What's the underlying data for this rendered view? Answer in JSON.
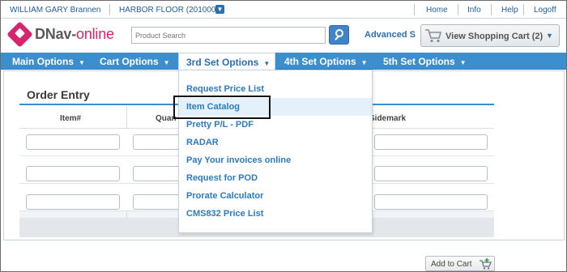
{
  "topbar": {
    "user": "WILLIAM GARY Brannen",
    "store": "HARBOR FLOOR (201000)",
    "links": [
      "Home",
      "Info",
      "Help",
      "Logoff"
    ]
  },
  "header": {
    "logo_main": "DNav-",
    "logo_accent": "online",
    "search_placeholder": "Product Search",
    "advanced_label": "Advanced S",
    "cart_label": "View Shopping Cart (2)"
  },
  "nav": {
    "items": [
      "Main Options",
      "Cart Options",
      "3rd Set Options",
      "4th Set Options",
      "5th Set Options"
    ],
    "active": "3rd Set Options"
  },
  "dropdown": {
    "items": [
      "Request Price List",
      "Item Catalog",
      "Pretty P/L - PDF",
      "RADAR",
      "Pay Your invoices online",
      "Request for POD",
      "Prorate Calculator",
      "CMS832 Price List"
    ],
    "highlighted": "Item Catalog"
  },
  "order_entry": {
    "title": "Order Entry",
    "columns": [
      "Item#",
      "Quan",
      "Sidemark"
    ],
    "add_to_cart_label": "Add to Cart"
  },
  "colors": {
    "nav_blue": "#3c8fcf",
    "link_blue": "#2a7bc2",
    "brand_magenta": "#d6246e"
  }
}
